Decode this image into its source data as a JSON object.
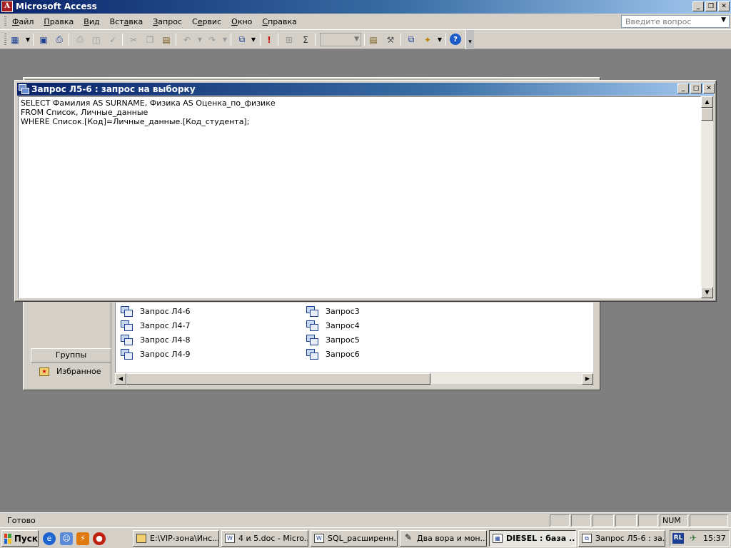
{
  "app": {
    "title": "Microsoft Access",
    "icon_letter": "A"
  },
  "menu": {
    "items": [
      {
        "u": "Ф",
        "rest": "айл"
      },
      {
        "u": "П",
        "rest": "равка"
      },
      {
        "u": "В",
        "rest": "ид"
      },
      {
        "u": "",
        "pre": "Вст",
        "uu": "а",
        "post": "вка"
      },
      {
        "u": "З",
        "rest": "апрос"
      },
      {
        "u": "",
        "pre": "С",
        "uu": "е",
        "post": "рвис"
      },
      {
        "u": "О",
        "rest": "кно"
      },
      {
        "u": "С",
        "rest": "правка"
      }
    ],
    "question_placeholder": "Введите вопрос"
  },
  "toolbar": {
    "icons": [
      "view-icon",
      "save-icon",
      "print-preview-icon",
      "print-icon",
      "preview-icon",
      "spelling-icon",
      "cut-icon",
      "copy-icon",
      "paste-icon",
      "undo-icon",
      "redo-icon",
      "query-type-icon",
      "run-icon",
      "show-table-icon",
      "totals-icon",
      "properties-icon",
      "build-icon",
      "database-window-icon",
      "new-object-icon",
      "help-icon"
    ]
  },
  "query_window": {
    "title": "Запрос Л5-6 : запрос на выборку",
    "sql_lines": [
      "SELECT Фамилия AS SURNAME, Физика AS Оценка_по_физике",
      "FROM Список, Личные_данные",
      "WHERE Список.[Код]=Личные_данные.[Код_студента];"
    ]
  },
  "db_window": {
    "groups_label": "Группы",
    "favorites_label": "Избранное",
    "column1": [
      "Запрос Л4-6",
      "Запрос Л4-7",
      "Запрос Л4-8",
      "Запрос Л4-9"
    ],
    "column2": [
      "Запрос3",
      "Запрос4",
      "Запрос5",
      "Запрос6"
    ]
  },
  "status": {
    "text": "Готово",
    "num": "NUM"
  },
  "taskbar": {
    "start_label": "Пуск",
    "tasks": [
      {
        "label": "E:\\VIP-зона\\Инс...",
        "icon": "folder-icon"
      },
      {
        "label": "4 и 5.doc - Micro...",
        "icon": "word-icon"
      },
      {
        "label": "SQL_расширенн...",
        "icon": "word-icon"
      },
      {
        "label": "Два вора и мон...",
        "icon": "media-icon"
      },
      {
        "label": "DIESEL : база ...",
        "icon": "access-icon",
        "active": true
      },
      {
        "label": "Запрос Л5-6 : за...",
        "icon": "query-icon"
      }
    ],
    "lang": "RL",
    "clock": "15:37"
  }
}
